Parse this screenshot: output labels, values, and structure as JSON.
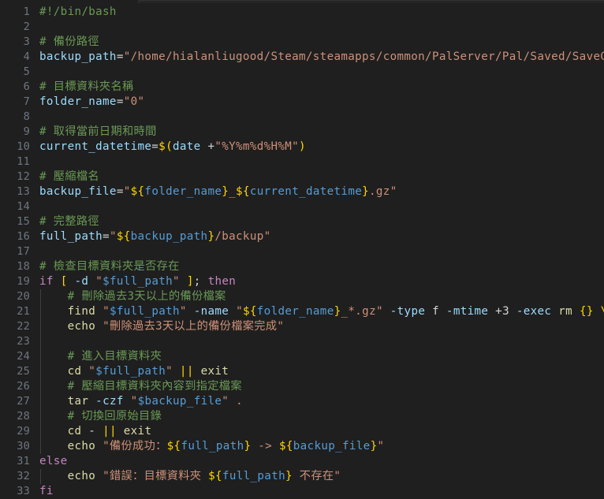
{
  "editor": {
    "name": "code-editor",
    "language": "bash",
    "background_color": "#1f1f1f",
    "line_number_color": "#6e7681",
    "total_lines": 33,
    "colors": {
      "comment": "#6a9955",
      "variable": "#9cdcfe",
      "string": "#ce9178",
      "keyword": "#c586c0",
      "function": "#dcdcaa",
      "bracket": "#ffd700",
      "expansion_variable": "#569cd6",
      "number": "#b5cea8",
      "default_text": "#d4d4d4"
    }
  },
  "lines": [
    {
      "n": "1",
      "indent": 0,
      "tokens": [
        {
          "t": "#!/bin/bash",
          "c": "cmt"
        }
      ]
    },
    {
      "n": "2",
      "indent": 0,
      "tokens": []
    },
    {
      "n": "3",
      "indent": 0,
      "tokens": [
        {
          "t": "# 備份路徑",
          "c": "cmt"
        }
      ]
    },
    {
      "n": "4",
      "indent": 0,
      "tokens": [
        {
          "t": "backup_path",
          "c": "var"
        },
        {
          "t": "=",
          "c": "op"
        },
        {
          "t": "\"/home/hialanliugood/Steam/steamapps/common/PalServer/Pal/Saved/SaveGames\"",
          "c": "str"
        }
      ]
    },
    {
      "n": "5",
      "indent": 0,
      "tokens": []
    },
    {
      "n": "6",
      "indent": 0,
      "tokens": [
        {
          "t": "# 目標資料夾名稱",
          "c": "cmt"
        }
      ]
    },
    {
      "n": "7",
      "indent": 0,
      "tokens": [
        {
          "t": "folder_name",
          "c": "var"
        },
        {
          "t": "=",
          "c": "op"
        },
        {
          "t": "\"0\"",
          "c": "str"
        }
      ]
    },
    {
      "n": "8",
      "indent": 0,
      "tokens": []
    },
    {
      "n": "9",
      "indent": 0,
      "tokens": [
        {
          "t": "# 取得當前日期和時間",
          "c": "cmt"
        }
      ]
    },
    {
      "n": "10",
      "indent": 0,
      "tokens": [
        {
          "t": "current_datetime",
          "c": "var"
        },
        {
          "t": "=",
          "c": "op"
        },
        {
          "t": "$(",
          "c": "brk"
        },
        {
          "t": "date",
          "c": "flag"
        },
        {
          "t": " +",
          "c": "op"
        },
        {
          "t": "\"%Y%m%d%H%M\"",
          "c": "str"
        },
        {
          "t": ")",
          "c": "brk"
        }
      ]
    },
    {
      "n": "11",
      "indent": 0,
      "tokens": []
    },
    {
      "n": "12",
      "indent": 0,
      "tokens": [
        {
          "t": "# 壓縮檔名",
          "c": "cmt"
        }
      ]
    },
    {
      "n": "13",
      "indent": 0,
      "tokens": [
        {
          "t": "backup_file",
          "c": "var"
        },
        {
          "t": "=",
          "c": "op"
        },
        {
          "t": "\"",
          "c": "str"
        },
        {
          "t": "${",
          "c": "brk"
        },
        {
          "t": "folder_name",
          "c": "dvar"
        },
        {
          "t": "}",
          "c": "brk"
        },
        {
          "t": "_",
          "c": "str"
        },
        {
          "t": "${",
          "c": "brk"
        },
        {
          "t": "current_datetime",
          "c": "dvar"
        },
        {
          "t": "}",
          "c": "brk"
        },
        {
          "t": ".gz\"",
          "c": "str"
        }
      ]
    },
    {
      "n": "14",
      "indent": 0,
      "tokens": []
    },
    {
      "n": "15",
      "indent": 0,
      "tokens": [
        {
          "t": "# 完整路徑",
          "c": "cmt"
        }
      ]
    },
    {
      "n": "16",
      "indent": 0,
      "tokens": [
        {
          "t": "full_path",
          "c": "var"
        },
        {
          "t": "=",
          "c": "op"
        },
        {
          "t": "\"",
          "c": "str"
        },
        {
          "t": "${",
          "c": "brk"
        },
        {
          "t": "backup_path",
          "c": "dvar"
        },
        {
          "t": "}",
          "c": "brk"
        },
        {
          "t": "/backup\"",
          "c": "str"
        }
      ]
    },
    {
      "n": "17",
      "indent": 0,
      "tokens": []
    },
    {
      "n": "18",
      "indent": 0,
      "tokens": [
        {
          "t": "# 檢查目標資料夾是否存在",
          "c": "cmt"
        }
      ]
    },
    {
      "n": "19",
      "indent": 0,
      "tokens": [
        {
          "t": "if",
          "c": "kw"
        },
        {
          "t": " ",
          "c": "op"
        },
        {
          "t": "[",
          "c": "brk"
        },
        {
          "t": " ",
          "c": "op"
        },
        {
          "t": "-d",
          "c": "flag"
        },
        {
          "t": " ",
          "c": "op"
        },
        {
          "t": "\"",
          "c": "str"
        },
        {
          "t": "$full_path",
          "c": "dvar"
        },
        {
          "t": "\"",
          "c": "str"
        },
        {
          "t": " ",
          "c": "op"
        },
        {
          "t": "]",
          "c": "brk"
        },
        {
          "t": "; ",
          "c": "op"
        },
        {
          "t": "then",
          "c": "kw"
        }
      ]
    },
    {
      "n": "20",
      "indent": 1,
      "tokens": [
        {
          "t": "# 刪除過去3天以上的備份檔案",
          "c": "cmt"
        }
      ]
    },
    {
      "n": "21",
      "indent": 1,
      "tokens": [
        {
          "t": "find",
          "c": "fn"
        },
        {
          "t": " ",
          "c": "op"
        },
        {
          "t": "\"",
          "c": "str"
        },
        {
          "t": "$full_path",
          "c": "dvar"
        },
        {
          "t": "\"",
          "c": "str"
        },
        {
          "t": " ",
          "c": "op"
        },
        {
          "t": "-name",
          "c": "flag"
        },
        {
          "t": " ",
          "c": "op"
        },
        {
          "t": "\"",
          "c": "str"
        },
        {
          "t": "${",
          "c": "brk"
        },
        {
          "t": "folder_name",
          "c": "dvar"
        },
        {
          "t": "}",
          "c": "brk"
        },
        {
          "t": "_*.gz\"",
          "c": "str"
        },
        {
          "t": " ",
          "c": "op"
        },
        {
          "t": "-type",
          "c": "flag"
        },
        {
          "t": " f ",
          "c": "op"
        },
        {
          "t": "-mtime",
          "c": "flag"
        },
        {
          "t": " +3 ",
          "c": "op"
        },
        {
          "t": "-exec",
          "c": "flag"
        },
        {
          "t": " ",
          "c": "op"
        },
        {
          "t": "rm",
          "c": "fn"
        },
        {
          "t": " ",
          "c": "op"
        },
        {
          "t": "{}",
          "c": "brk"
        },
        {
          "t": " ",
          "c": "op"
        },
        {
          "t": "\\;",
          "c": "brk"
        }
      ]
    },
    {
      "n": "22",
      "indent": 1,
      "tokens": [
        {
          "t": "echo",
          "c": "fn"
        },
        {
          "t": " ",
          "c": "op"
        },
        {
          "t": "\"刪除過去3天以上的備份檔案完成\"",
          "c": "str"
        }
      ]
    },
    {
      "n": "23",
      "indent": 1,
      "tokens": []
    },
    {
      "n": "24",
      "indent": 1,
      "tokens": [
        {
          "t": "# 進入目標資料夾",
          "c": "cmt"
        }
      ]
    },
    {
      "n": "25",
      "indent": 1,
      "tokens": [
        {
          "t": "cd",
          "c": "fn"
        },
        {
          "t": " ",
          "c": "op"
        },
        {
          "t": "\"",
          "c": "str"
        },
        {
          "t": "$full_path",
          "c": "dvar"
        },
        {
          "t": "\"",
          "c": "str"
        },
        {
          "t": " ",
          "c": "op"
        },
        {
          "t": "||",
          "c": "brk"
        },
        {
          "t": " ",
          "c": "op"
        },
        {
          "t": "exit",
          "c": "fn"
        }
      ]
    },
    {
      "n": "26",
      "indent": 1,
      "tokens": [
        {
          "t": "# 壓縮目標資料夾內容到指定檔案",
          "c": "cmt"
        }
      ]
    },
    {
      "n": "27",
      "indent": 1,
      "tokens": [
        {
          "t": "tar",
          "c": "fn"
        },
        {
          "t": " ",
          "c": "op"
        },
        {
          "t": "-czf",
          "c": "flag"
        },
        {
          "t": " ",
          "c": "op"
        },
        {
          "t": "\"",
          "c": "str"
        },
        {
          "t": "$backup_file",
          "c": "dvar"
        },
        {
          "t": "\"",
          "c": "str"
        },
        {
          "t": " ",
          "c": "op"
        },
        {
          "t": ".",
          "c": "str"
        }
      ]
    },
    {
      "n": "28",
      "indent": 1,
      "tokens": [
        {
          "t": "# 切換回原始目錄",
          "c": "cmt"
        }
      ]
    },
    {
      "n": "29",
      "indent": 1,
      "tokens": [
        {
          "t": "cd",
          "c": "fn"
        },
        {
          "t": " - ",
          "c": "op"
        },
        {
          "t": "||",
          "c": "brk"
        },
        {
          "t": " ",
          "c": "op"
        },
        {
          "t": "exit",
          "c": "fn"
        }
      ]
    },
    {
      "n": "30",
      "indent": 1,
      "tokens": [
        {
          "t": "echo",
          "c": "fn"
        },
        {
          "t": " ",
          "c": "op"
        },
        {
          "t": "\"備份成功：",
          "c": "str"
        },
        {
          "t": "${",
          "c": "brk"
        },
        {
          "t": "full_path",
          "c": "dvar"
        },
        {
          "t": "}",
          "c": "brk"
        },
        {
          "t": " -> ",
          "c": "str"
        },
        {
          "t": "${",
          "c": "brk"
        },
        {
          "t": "backup_file",
          "c": "dvar"
        },
        {
          "t": "}",
          "c": "brk"
        },
        {
          "t": "\"",
          "c": "str"
        }
      ]
    },
    {
      "n": "31",
      "indent": 0,
      "tokens": [
        {
          "t": "else",
          "c": "kw"
        }
      ]
    },
    {
      "n": "32",
      "indent": 1,
      "tokens": [
        {
          "t": "echo",
          "c": "fn"
        },
        {
          "t": " ",
          "c": "op"
        },
        {
          "t": "\"錯誤：目標資料夾 ",
          "c": "str"
        },
        {
          "t": "${",
          "c": "brk"
        },
        {
          "t": "full_path",
          "c": "dvar"
        },
        {
          "t": "}",
          "c": "brk"
        },
        {
          "t": " 不存在\"",
          "c": "str"
        }
      ]
    },
    {
      "n": "33",
      "indent": 0,
      "tokens": [
        {
          "t": "fi",
          "c": "kw"
        }
      ]
    }
  ]
}
